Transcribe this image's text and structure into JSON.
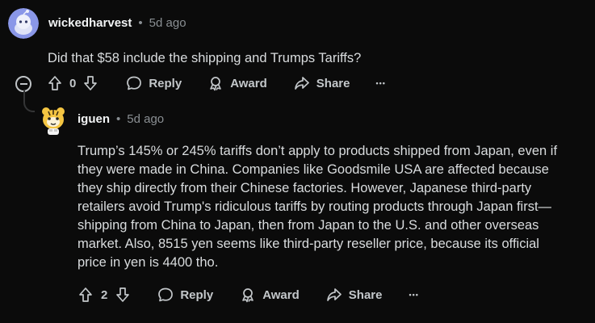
{
  "comments": [
    {
      "username": "wickedharvest",
      "separator": "•",
      "time": "5d ago",
      "body": "Did that $58 include the shipping and Trumps Tariffs?",
      "score": "0",
      "reply_label": "Reply",
      "award_label": "Award",
      "share_label": "Share",
      "more_label": "•••"
    },
    {
      "username": "iguen",
      "separator": "•",
      "time": "5d ago",
      "body": "Trump’s 145% or 245% tariffs don’t apply to products shipped from Japan, even if they were made in China. Companies like Goodsmile USA are affected because they ship directly from their Chinese factories. However, Japanese third-party retailers avoid Trump's ridiculous tariffs by routing products through Japan first—shipping from China to Japan, then from Japan to the U.S. and other overseas market. Also, 8515 yen seems like third-party reseller price, because its official price in yen is 4400 tho.",
      "score": "2",
      "reply_label": "Reply",
      "award_label": "Award",
      "share_label": "Share",
      "more_label": "•••"
    }
  ],
  "icons": {
    "upvote": "arrow-up-icon",
    "downvote": "arrow-down-icon",
    "reply": "speech-bubble-icon",
    "award": "award-icon",
    "share": "share-arrow-icon",
    "collapse": "collapse-minus-icon"
  },
  "colors": {
    "background": "#0b0b0b",
    "text": "#d9dcde",
    "muted": "#8a8f93",
    "avatar_blue": "#8a97e8",
    "avatar_yellow": "#f4c542"
  }
}
